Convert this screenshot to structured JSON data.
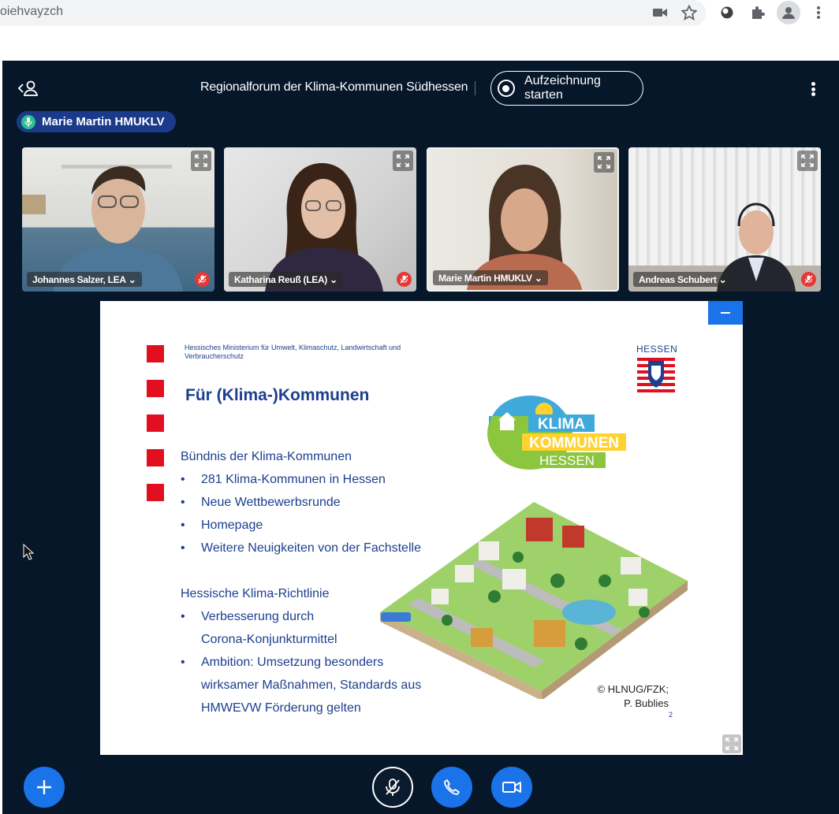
{
  "browser": {
    "url_fragment": "oiehvayzch",
    "icons": [
      "video-camera-icon",
      "star-icon",
      "extension-circle-icon",
      "puzzle-icon",
      "profile-icon",
      "kebab-menu-icon"
    ]
  },
  "meeting": {
    "title": "Regionalforum der Klima-Kommunen Südhessen",
    "record_label": "Aufzeichnung starten",
    "active_speaker": "Marie Martin HMUKLV"
  },
  "participants": [
    {
      "name": "Johannes Salzer, LEA",
      "muted": true
    },
    {
      "name": "Katharina Reuß (LEA)",
      "muted": true
    },
    {
      "name": "Marie Martin HMUKLV",
      "muted": false
    },
    {
      "name": "Andreas Schubert",
      "muted": true
    }
  ],
  "slide": {
    "ministry": "Hessisches Ministerium für Umwelt, Klimaschutz, Landwirtschaft und Verbraucherschutz",
    "title": "Für (Klima-)Kommunen",
    "section1": "Bündnis der Klima-Kommunen",
    "bullets1": [
      "281 Klima-Kommunen in Hessen",
      "Neue Wettbewerbsrunde",
      "Homepage",
      "Weitere Neuigkeiten von der Fachstelle"
    ],
    "section2": "Hessische Klima-Richtlinie",
    "bullet2a": "Verbesserung durch",
    "bullet2a_cont": "Corona-Konjunkturmittel",
    "bullet2b": "Ambition: Umsetzung besonders",
    "bullet2b_cont1": "wirksamer Maßnahmen, Standards aus",
    "bullet2b_cont2": "HMWEVW Förderung gelten",
    "bullet_marker": "•",
    "hessen": "HESSEN",
    "logo_line1": "KLIMA",
    "logo_line2": "KOMMUNEN",
    "logo_line3": "HESSEN",
    "credit1": "© HLNUG/FZK;",
    "credit2": "P. Bublies",
    "page": "2"
  },
  "colors": {
    "meeting_bg": "#06172a",
    "accent_blue": "#1a73e8",
    "slide_text": "#1d3f8f",
    "slide_red": "#e10f1f",
    "muted_red": "#e53935"
  }
}
